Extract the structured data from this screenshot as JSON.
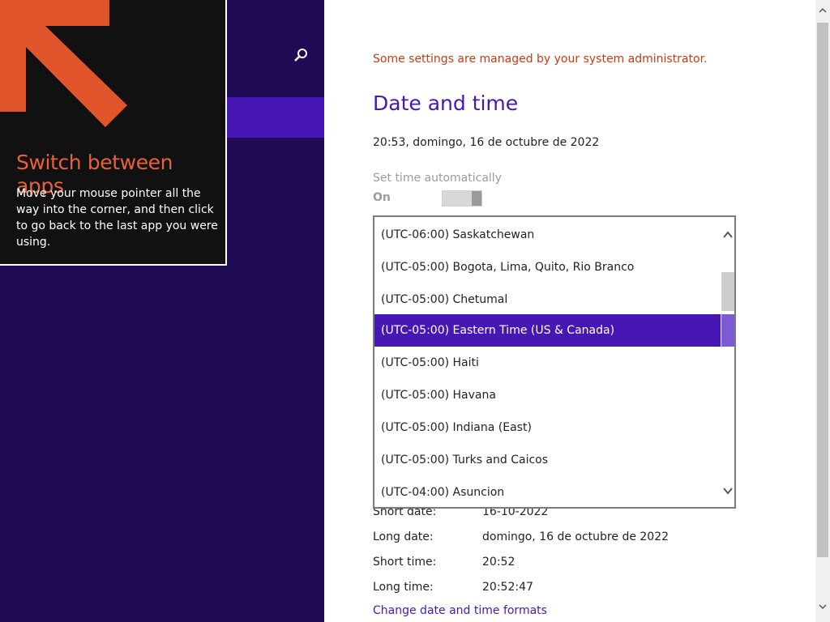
{
  "tip": {
    "title": "Switch between apps",
    "body": "Move your mouse pointer all the way into the corner, and then click to go back to the last app you were using."
  },
  "left_pane": {
    "search_icon": "search-icon"
  },
  "settings": {
    "admin_notice": "Some settings are managed by your system administrator.",
    "title": "Date and time",
    "current_datetime": "20:53, domingo, 16 de octubre de 2022",
    "set_time_auto_label": "Set time automatically",
    "set_time_auto_state": "On"
  },
  "timezone_dropdown": {
    "items": [
      "(UTC-06:00) Saskatchewan",
      "(UTC-05:00) Bogota, Lima, Quito, Rio Branco",
      "(UTC-05:00) Chetumal",
      "(UTC-05:00) Eastern Time (US & Canada)",
      "(UTC-05:00) Haiti",
      "(UTC-05:00) Havana",
      "(UTC-05:00) Indiana (East)",
      "(UTC-05:00) Turks and Caicos",
      "(UTC-04:00) Asuncion"
    ],
    "selected": "(UTC-05:00) Eastern Time (US & Canada)"
  },
  "formats": {
    "short_date": {
      "label": "Short date:",
      "value": "16-10-2022"
    },
    "long_date": {
      "label": "Long date:",
      "value": "domingo, 16 de octubre de 2022"
    },
    "short_time": {
      "label": "Short time:",
      "value": "20:52"
    },
    "long_time": {
      "label": "Long time:",
      "value": "20:52:47"
    },
    "change_link": "Change date and time formats"
  },
  "colors": {
    "accent": "#4617b4",
    "left_pane_bg": "#1f0a55",
    "tip_title": "#e8613b",
    "admin_notice": "#c93a0e"
  }
}
